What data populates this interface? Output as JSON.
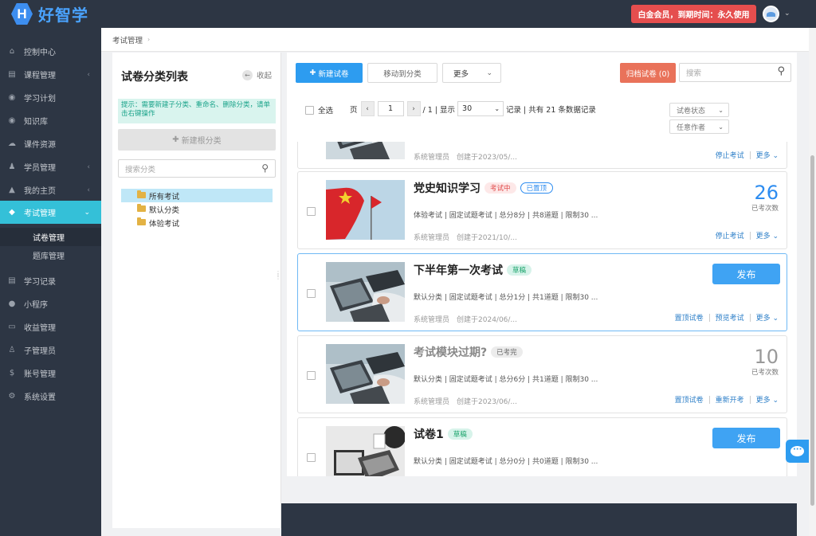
{
  "header": {
    "logo_letter": "H",
    "logo_text": "好智学",
    "member_badge": "白金会员，到期时间：永久使用"
  },
  "sidebar": {
    "items": [
      {
        "icon": "home-icon",
        "glyph": "⌂",
        "label": "控制中心",
        "arrow": ""
      },
      {
        "icon": "book-icon",
        "glyph": "▤",
        "label": "课程管理",
        "arrow": "‹"
      },
      {
        "icon": "eye-icon",
        "glyph": "◉",
        "label": "学习计划",
        "arrow": ""
      },
      {
        "icon": "eye-icon",
        "glyph": "◉",
        "label": "知识库",
        "arrow": ""
      },
      {
        "icon": "cloud-icon",
        "glyph": "☁",
        "label": "课件资源",
        "arrow": ""
      },
      {
        "icon": "users-icon",
        "glyph": "♟",
        "label": "学员管理",
        "arrow": "‹"
      },
      {
        "icon": "graduation-icon",
        "glyph": "▲",
        "label": "我的主页",
        "arrow": "‹"
      },
      {
        "icon": "tag-icon",
        "glyph": "◆",
        "label": "考试管理",
        "arrow": "⌄"
      },
      {
        "icon": "book-icon",
        "glyph": "▤",
        "label": "学习记录",
        "arrow": ""
      },
      {
        "icon": "wechat-icon",
        "glyph": "●",
        "label": "小程序",
        "arrow": ""
      },
      {
        "icon": "card-icon",
        "glyph": "▭",
        "label": "收益管理",
        "arrow": ""
      },
      {
        "icon": "user-lock-icon",
        "glyph": "♙",
        "label": "子管理员",
        "arrow": ""
      },
      {
        "icon": "dollar-icon",
        "glyph": "$",
        "label": "账号管理",
        "arrow": ""
      },
      {
        "icon": "gear-icon",
        "glyph": "⚙",
        "label": "系统设置",
        "arrow": ""
      }
    ],
    "sub_items": [
      "试卷管理",
      "题库管理"
    ]
  },
  "breadcrumb": {
    "current": "考试管理",
    "sep": "›"
  },
  "category_panel": {
    "title": "试卷分类列表",
    "collapse_label": "收起",
    "tip": "提示：需要新建子分类、重命名、删除分类，请单击右键操作",
    "new_root_label": "新建根分类",
    "search_placeholder": "搜索分类",
    "tree": [
      "所有考试",
      "默认分类",
      "体验考试"
    ]
  },
  "toolbar": {
    "new_label": "新建试卷",
    "move_label": "移动到分类",
    "more_label": "更多",
    "archive_label": "归档试卷 (0)",
    "search_placeholder": "搜索"
  },
  "filters": {
    "select_all": "全选",
    "page_label": "页",
    "page_value": "1",
    "page_total": "/ 1 | 显示",
    "page_size": "30",
    "records": "记录 | 共有 21 条数据记录",
    "status_select": "试卷状态",
    "author_select": "任意作者"
  },
  "exams": [
    {
      "title": "",
      "tags": [],
      "meta": "",
      "author": "系统管理员",
      "created": "创建于2023/05/...",
      "count": "",
      "count_label": "",
      "publish": "",
      "actions": [
        "停止考试",
        "更多 ⌄"
      ]
    },
    {
      "title": "党史知识学习",
      "tags": [
        {
          "text": "考试中",
          "style": "red"
        },
        {
          "text": "已置顶",
          "style": "blue"
        }
      ],
      "meta": "体验考试 | 固定试题考试 | 总分8分 | 共8道题 | 限制30 ...",
      "author": "系统管理员",
      "created": "创建于2021/10/...",
      "count": "26",
      "count_label": "已考次数",
      "publish": "",
      "actions": [
        "停止考试",
        "更多 ⌄"
      ]
    },
    {
      "title": "下半年第一次考试",
      "tags": [
        {
          "text": "草稿",
          "style": "green"
        }
      ],
      "meta": "默认分类 | 固定试题考试 | 总分1分 | 共1道题 | 限制30 ...",
      "author": "系统管理员",
      "created": "创建于2024/06/...",
      "count": "",
      "count_label": "",
      "publish": "发布",
      "actions": [
        "置顶试卷",
        "预览考试",
        "更多 ⌄"
      ]
    },
    {
      "title": "考试模块过期?",
      "tags": [
        {
          "text": "已考完",
          "style": "gray"
        }
      ],
      "meta": "默认分类 | 固定试题考试 | 总分6分 | 共1道题 | 限制30 ...",
      "author": "系统管理员",
      "created": "创建于2023/06/...",
      "count": "10",
      "count_label": "已考次数",
      "publish": "",
      "actions": [
        "置顶试卷",
        "重新开考",
        "更多 ⌄"
      ]
    },
    {
      "title": "试卷1",
      "tags": [
        {
          "text": "草稿",
          "style": "green"
        }
      ],
      "meta": "默认分类 | 固定试题考试 | 总分0分 | 共0道题 | 限制30 ...",
      "author": "",
      "created": "",
      "count": "",
      "count_label": "",
      "publish": "发布",
      "actions": []
    }
  ]
}
